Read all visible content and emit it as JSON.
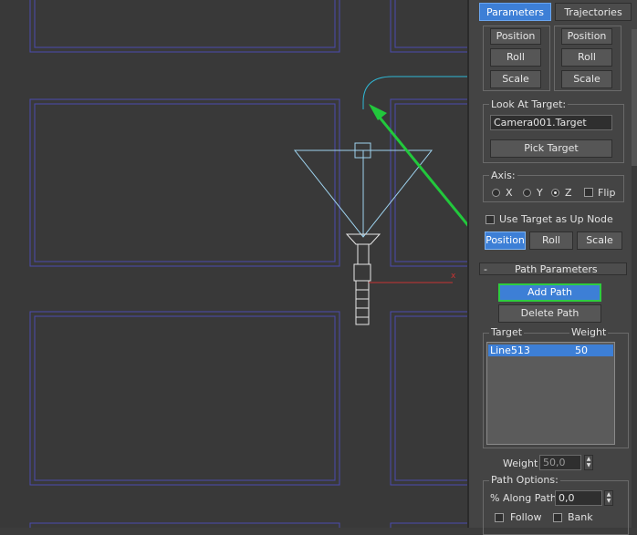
{
  "tabs": {
    "parameters": "Parameters",
    "trajectories": "Trajectories"
  },
  "top_buttons": {
    "left": {
      "position": "Position",
      "roll": "Roll",
      "scale": "Scale"
    },
    "right": {
      "position": "Position",
      "roll": "Roll",
      "scale": "Scale"
    }
  },
  "look_at_target": {
    "label": "Look At Target:",
    "value": "Camera001.Target",
    "pick_button": "Pick Target"
  },
  "axis": {
    "label": "Axis:",
    "x": "X",
    "y": "Y",
    "z": "Z",
    "selected": "Z",
    "flip": "Flip"
  },
  "use_target_up": "Use Target as Up Node",
  "mode_buttons": {
    "position": "Position",
    "roll": "Roll",
    "scale": "Scale",
    "active": "Position"
  },
  "path_parameters": {
    "rollout_sign": "-",
    "title": "Path Parameters",
    "add_path": "Add Path",
    "delete_path": "Delete Path",
    "list": {
      "col_target": "Target",
      "col_weight": "Weight",
      "rows": [
        {
          "target": "Line513",
          "weight": "50"
        }
      ]
    },
    "weight_label": "Weight",
    "weight_value": "50,0"
  },
  "path_options": {
    "label": "Path Options:",
    "along_path_label": "% Along Path:",
    "along_path_value": "0,0",
    "follow": "Follow",
    "bank": "Bank"
  },
  "colors": {
    "accent": "#3d7fd6",
    "highlight_border": "#2ecc40",
    "arrow": "#22c83c",
    "grid_lines": "#5050b4",
    "path_line": "#2fb9d6"
  }
}
